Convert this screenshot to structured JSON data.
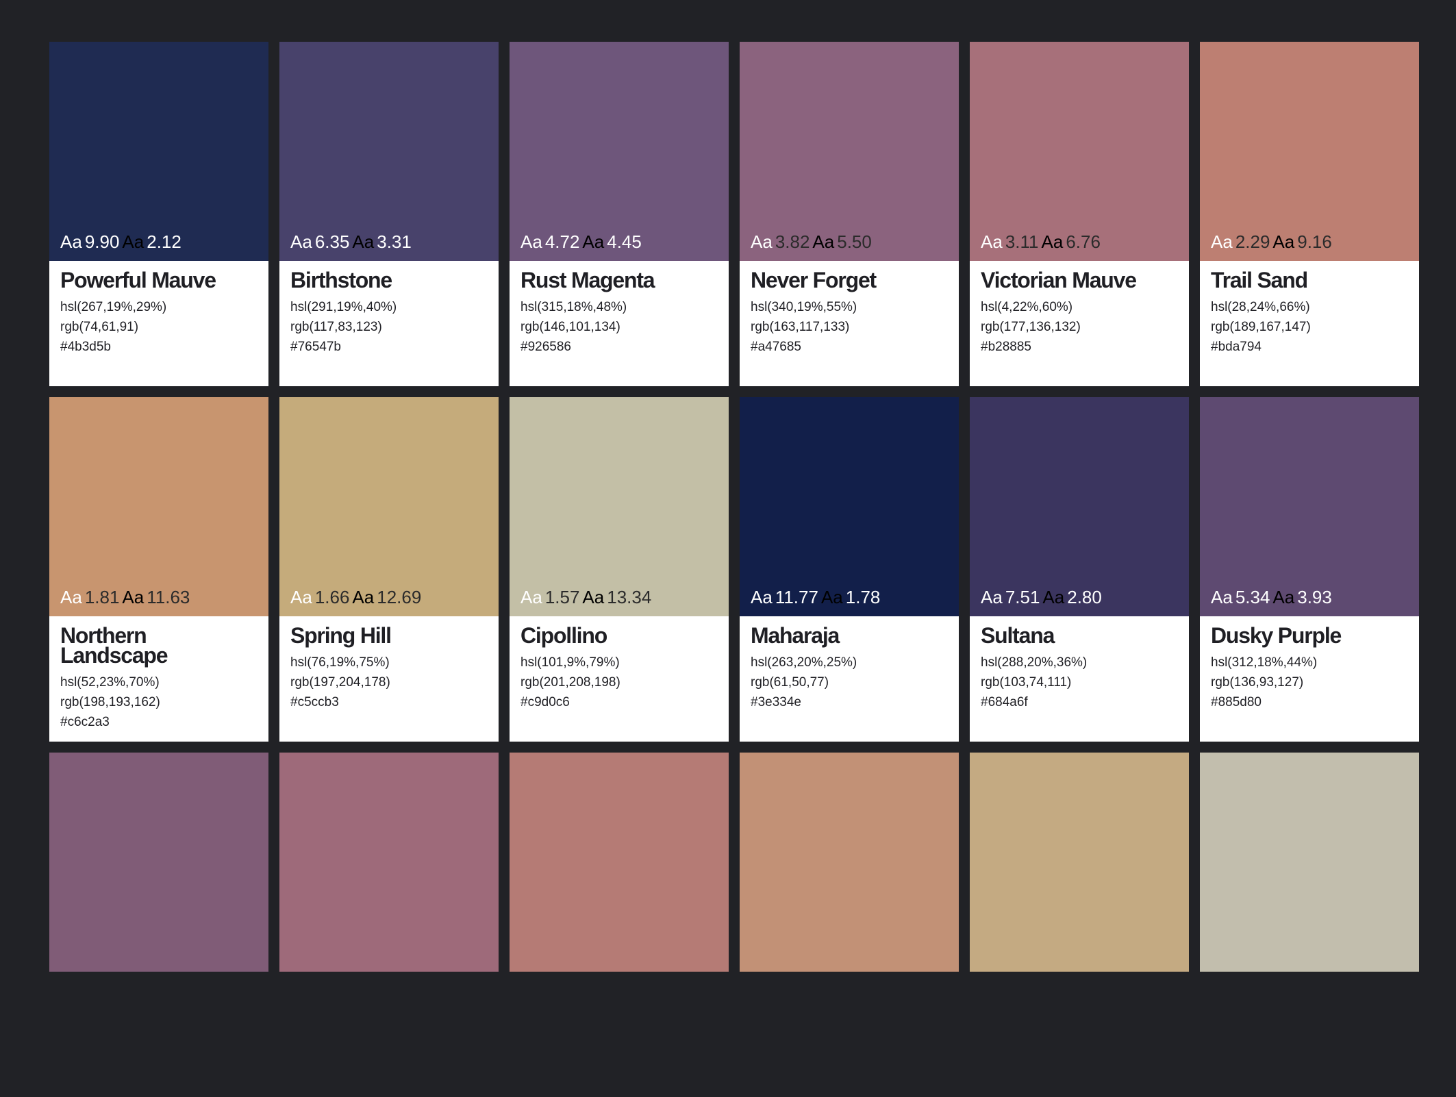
{
  "colors": {
    "light_text": "#ffffff",
    "dark_text": "#000000",
    "background": "#212226"
  },
  "cards": [
    {
      "swatch": "#1f2b52",
      "name": "Powerful Mauve",
      "hsl": "hsl(267,19%,29%)",
      "rgb": "rgb(74,61,91)",
      "hex": "#4b3d5b",
      "white_label": "Aa",
      "white_ratio": "9.90",
      "black_label": "Aa",
      "black_ratio": "2.12",
      "white_color": "#ffffff",
      "black_color": "#000000",
      "ratio1_color": "#ffffff",
      "ratio2_color": "#ffffff"
    },
    {
      "swatch": "#48426b",
      "name": "Birthstone",
      "hsl": "hsl(291,19%,40%)",
      "rgb": "rgb(117,83,123)",
      "hex": "#76547b",
      "white_label": "Aa",
      "white_ratio": "6.35",
      "black_label": "Aa",
      "black_ratio": "3.31",
      "white_color": "#ffffff",
      "black_color": "#000000",
      "ratio1_color": "#ffffff",
      "ratio2_color": "#ffffff"
    },
    {
      "swatch": "#6e567b",
      "name": "Rust Magenta",
      "hsl": "hsl(315,18%,48%)",
      "rgb": "rgb(146,101,134)",
      "hex": "#926586",
      "white_label": "Aa",
      "white_ratio": "4.72",
      "black_label": "Aa",
      "black_ratio": "4.45",
      "white_color": "#ffffff",
      "black_color": "#000000",
      "ratio1_color": "#ffffff",
      "ratio2_color": "#ffffff"
    },
    {
      "swatch": "#8b637e",
      "name": "Never Forget",
      "hsl": "hsl(340,19%,55%)",
      "rgb": "rgb(163,117,133)",
      "hex": "#a47685",
      "white_label": "Aa",
      "white_ratio": "3.82",
      "black_label": "Aa",
      "black_ratio": "5.50",
      "white_color": "#ffffff",
      "black_color": "#000000",
      "ratio1_color": "#2b2b2b",
      "ratio2_color": "#2b2b2b"
    },
    {
      "swatch": "#a7707a",
      "name": "Victorian Mauve",
      "hsl": "hsl(4,22%,60%)",
      "rgb": "rgb(177,136,132)",
      "hex": "#b28885",
      "white_label": "Aa",
      "white_ratio": "3.11",
      "black_label": "Aa",
      "black_ratio": "6.76",
      "white_color": "#ffffff",
      "black_color": "#000000",
      "ratio1_color": "#2b2b2b",
      "ratio2_color": "#2b2b2b"
    },
    {
      "swatch": "#bd7f72",
      "name": "Trail Sand",
      "hsl": "hsl(28,24%,66%)",
      "rgb": "rgb(189,167,147)",
      "hex": "#bda794",
      "white_label": "Aa",
      "white_ratio": "2.29",
      "black_label": "Aa",
      "black_ratio": "9.16",
      "white_color": "#ffffff",
      "black_color": "#000000",
      "ratio1_color": "#2b2b2b",
      "ratio2_color": "#2b2b2b"
    },
    {
      "swatch": "#c8956f",
      "name": "Northern Landscape",
      "hsl": "hsl(52,23%,70%)",
      "rgb": "rgb(198,193,162)",
      "hex": "#c6c2a3",
      "white_label": "Aa",
      "white_ratio": "1.81",
      "black_label": "Aa",
      "black_ratio": "11.63",
      "white_color": "#ffffff",
      "black_color": "#000000",
      "ratio1_color": "#2b2b2b",
      "ratio2_color": "#2b2b2b"
    },
    {
      "swatch": "#c5ab7b",
      "name": "Spring Hill",
      "hsl": "hsl(76,19%,75%)",
      "rgb": "rgb(197,204,178)",
      "hex": "#c5ccb3",
      "white_label": "Aa",
      "white_ratio": "1.66",
      "black_label": "Aa",
      "black_ratio": "12.69",
      "white_color": "#ffffff",
      "black_color": "#000000",
      "ratio1_color": "#2b2b2b",
      "ratio2_color": "#2b2b2b"
    },
    {
      "swatch": "#c3bfa6",
      "name": "Cipollino",
      "hsl": "hsl(101,9%,79%)",
      "rgb": "rgb(201,208,198)",
      "hex": "#c9d0c6",
      "white_label": "Aa",
      "white_ratio": "1.57",
      "black_label": "Aa",
      "black_ratio": "13.34",
      "white_color": "#ffffff",
      "black_color": "#000000",
      "ratio1_color": "#2b2b2b",
      "ratio2_color": "#2b2b2b"
    },
    {
      "swatch": "#121f4a",
      "name": "Maharaja",
      "hsl": "hsl(263,20%,25%)",
      "rgb": "rgb(61,50,77)",
      "hex": "#3e334e",
      "white_label": "Aa",
      "white_ratio": "11.77",
      "black_label": "Aa",
      "black_ratio": "1.78",
      "white_color": "#ffffff",
      "black_color": "#000000",
      "ratio1_color": "#ffffff",
      "ratio2_color": "#ffffff"
    },
    {
      "swatch": "#3b355f",
      "name": "Sultana",
      "hsl": "hsl(288,20%,36%)",
      "rgb": "rgb(103,74,111)",
      "hex": "#684a6f",
      "white_label": "Aa",
      "white_ratio": "7.51",
      "black_label": "Aa",
      "black_ratio": "2.80",
      "white_color": "#ffffff",
      "black_color": "#000000",
      "ratio1_color": "#ffffff",
      "ratio2_color": "#ffffff"
    },
    {
      "swatch": "#5e4a71",
      "name": "Dusky Purple",
      "hsl": "hsl(312,18%,44%)",
      "rgb": "rgb(136,93,127)",
      "hex": "#885d80",
      "white_label": "Aa",
      "white_ratio": "5.34",
      "black_label": "Aa",
      "black_ratio": "3.93",
      "white_color": "#ffffff",
      "black_color": "#000000",
      "ratio1_color": "#ffffff",
      "ratio2_color": "#ffffff"
    }
  ],
  "partial_swatches": [
    "#805c77",
    "#9e6a7a",
    "#b57b75",
    "#c29176",
    "#c4aa82",
    "#c2bead"
  ]
}
